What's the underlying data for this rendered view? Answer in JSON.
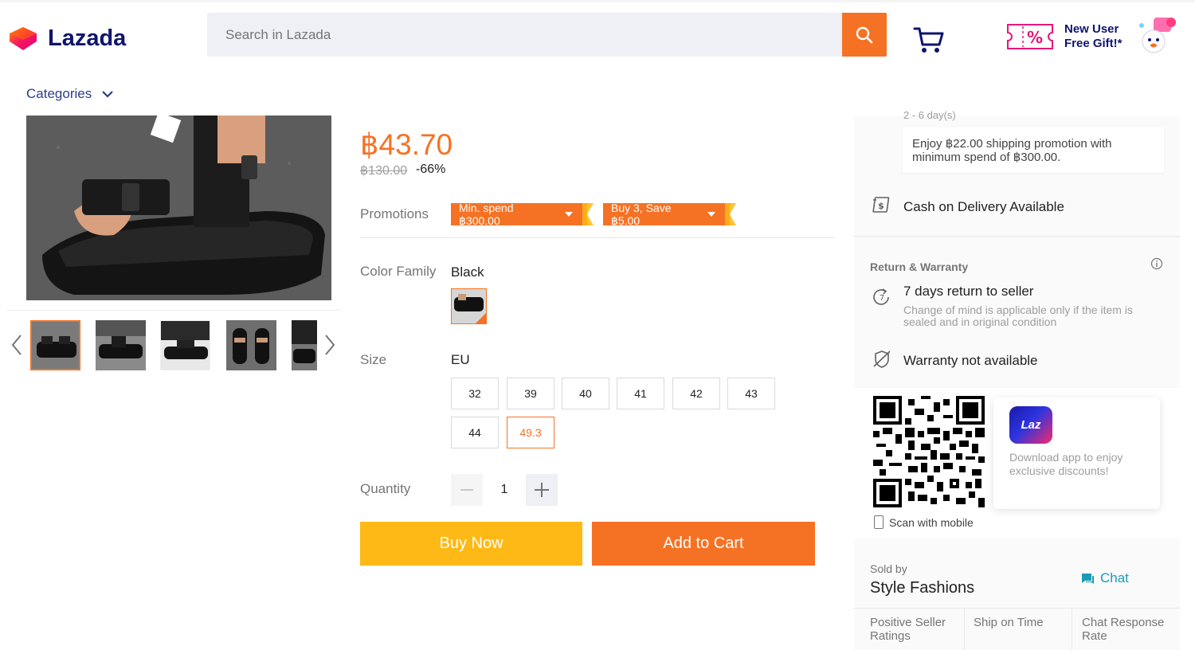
{
  "header": {
    "logo_text": "Lazada",
    "search_placeholder": "Search in Lazada",
    "promo_line1": "New User",
    "promo_line2": "Free Gift!*",
    "categories_label": "Categories"
  },
  "product": {
    "price": "฿43.70",
    "original_price": "฿130.00",
    "discount": "-66%",
    "promotions_label": "Promotions",
    "promotions": [
      "Min. spend ฿300.00",
      "Buy 3, Save ฿5.00"
    ],
    "color_label": "Color Family",
    "color_value": "Black",
    "size_label": "Size",
    "size_unit": "EU",
    "sizes": [
      "32",
      "39",
      "40",
      "41",
      "42",
      "43",
      "44",
      "49.3"
    ],
    "selected_size": "49.3",
    "quantity_label": "Quantity",
    "quantity": "1",
    "buy_now": "Buy Now",
    "add_to_cart": "Add to Cart"
  },
  "delivery": {
    "eta_partial": "2 - 6 day(s)",
    "shipping_note": "Enjoy ฿22.00 shipping promotion with minimum spend of ฿300.00.",
    "cod": "Cash on Delivery Available"
  },
  "return_warranty": {
    "title": "Return & Warranty",
    "return_title": "7 days return to seller",
    "return_sub": "Change of mind is applicable only if the item is sealed and in original condition",
    "warranty": "Warranty not available"
  },
  "app_promo": {
    "icon_text": "Laz",
    "text": "Download app to enjoy exclusive discounts!",
    "scan_label": "Scan with mobile"
  },
  "seller": {
    "sold_by_label": "Sold by",
    "name": "Style Fashions",
    "chat_label": "Chat",
    "metrics": [
      "Positive Seller Ratings",
      "Ship on Time",
      "Chat Response Rate"
    ]
  },
  "colors": {
    "accent": "#f57224",
    "buy_now": "#ffb916",
    "link": "#1a9cb7",
    "brand_text": "#0f146d"
  }
}
